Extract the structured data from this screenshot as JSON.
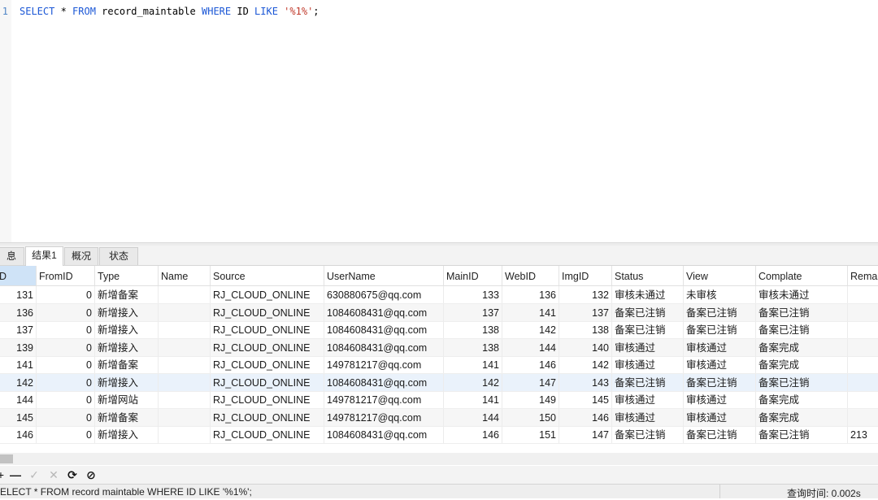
{
  "editor": {
    "line_number": "1",
    "tokens": [
      {
        "text": "SELECT",
        "kind": "kw"
      },
      {
        "text": " * ",
        "kind": "plain"
      },
      {
        "text": "FROM",
        "kind": "kw"
      },
      {
        "text": " record_maintable ",
        "kind": "plain"
      },
      {
        "text": "WHERE",
        "kind": "kw"
      },
      {
        "text": " ID ",
        "kind": "plain"
      },
      {
        "text": "LIKE",
        "kind": "kw"
      },
      {
        "text": " ",
        "kind": "plain"
      },
      {
        "text": "'%1%'",
        "kind": "str"
      },
      {
        "text": ";",
        "kind": "plain"
      }
    ]
  },
  "tabs": [
    {
      "label": "息",
      "active": false
    },
    {
      "label": "结果1",
      "active": true
    },
    {
      "label": "概况",
      "active": false
    },
    {
      "label": "状态",
      "active": false
    }
  ],
  "grid": {
    "columns": [
      "D",
      "FromID",
      "Type",
      "Name",
      "Source",
      "UserName",
      "MainID",
      "WebID",
      "ImgID",
      "Status",
      "View",
      "Complate",
      "Remar"
    ],
    "rows": [
      [
        "131",
        "0",
        "新增备案",
        "",
        "RJ_CLOUD_ONLINE",
        "630880675@qq.com",
        "133",
        "136",
        "132",
        "审核未通过",
        "未审核",
        "审核未通过",
        ""
      ],
      [
        "136",
        "0",
        "新增接入",
        "",
        "RJ_CLOUD_ONLINE",
        "1084608431@qq.com",
        "137",
        "141",
        "137",
        "备案已注销",
        "备案已注销",
        "备案已注销",
        ""
      ],
      [
        "137",
        "0",
        "新增接入",
        "",
        "RJ_CLOUD_ONLINE",
        "1084608431@qq.com",
        "138",
        "142",
        "138",
        "备案已注销",
        "备案已注销",
        "备案已注销",
        ""
      ],
      [
        "139",
        "0",
        "新增接入",
        "",
        "RJ_CLOUD_ONLINE",
        "1084608431@qq.com",
        "138",
        "144",
        "140",
        "审核通过",
        "审核通过",
        "备案完成",
        ""
      ],
      [
        "141",
        "0",
        "新增备案",
        "",
        "RJ_CLOUD_ONLINE",
        "149781217@qq.com",
        "141",
        "146",
        "142",
        "审核通过",
        "审核通过",
        "备案完成",
        ""
      ],
      [
        "142",
        "0",
        "新增接入",
        "",
        "RJ_CLOUD_ONLINE",
        "1084608431@qq.com",
        "142",
        "147",
        "143",
        "备案已注销",
        "备案已注销",
        "备案已注销",
        ""
      ],
      [
        "144",
        "0",
        "新增网站",
        "",
        "RJ_CLOUD_ONLINE",
        "149781217@qq.com",
        "141",
        "149",
        "145",
        "审核通过",
        "审核通过",
        "备案完成",
        ""
      ],
      [
        "145",
        "0",
        "新增备案",
        "",
        "RJ_CLOUD_ONLINE",
        "149781217@qq.com",
        "144",
        "150",
        "146",
        "审核通过",
        "审核通过",
        "备案完成",
        ""
      ],
      [
        "146",
        "0",
        "新增接入",
        "",
        "RJ_CLOUD_ONLINE",
        "1084608431@qq.com",
        "146",
        "151",
        "147",
        "备案已注销",
        "备案已注销",
        "备案已注销",
        "213"
      ]
    ]
  },
  "toolbar": {
    "add_icon": "plus-icon",
    "delete_icon": "minus-icon",
    "apply_icon": "check-icon",
    "discard_icon": "x-icon",
    "refresh_icon": "refresh-icon",
    "stop_icon": "stop-icon"
  },
  "status": {
    "sql": "ELECT * FROM record maintable WHERE ID LIKE '%1%';",
    "time": "查询时间: 0.002s"
  }
}
